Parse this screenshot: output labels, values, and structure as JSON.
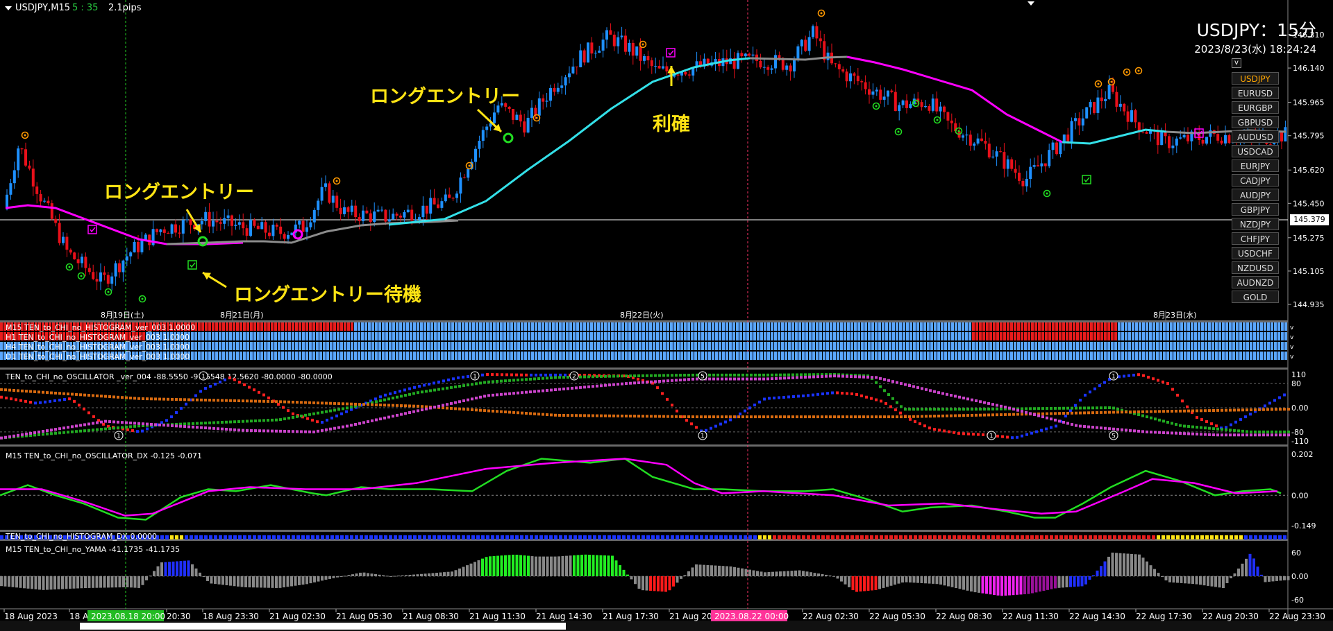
{
  "chart_header": {
    "symbol_timeframe": "USDJPY,M15",
    "countdown": "5 : 35",
    "spread": "2.1pips"
  },
  "overlay": {
    "title": "USDJPY：15分",
    "datetime": "2023/8/23(水) 18:24:24",
    "v_button": "v"
  },
  "symbols": [
    "USDJPY",
    "EURUSD",
    "EURGBP",
    "GBPUSD",
    "AUDUSD",
    "USDCAD",
    "EURJPY",
    "CADJPY",
    "AUDJPY",
    "GBPJPY",
    "NZDJPY",
    "CHFJPY",
    "USDCHF",
    "NZDUSD",
    "AUDNZD",
    "GOLD"
  ],
  "active_symbol": "USDJPY",
  "annotations": {
    "long_entry_1": "ロングエントリー",
    "long_entry_2": "ロングエントリー",
    "long_entry_wait": "ロングエントリー待機",
    "take_profit": "利確"
  },
  "colors": {
    "background": "#000000",
    "bull": "#1e90ff",
    "bear": "#e8101a",
    "ma_magenta": "#ff00ff",
    "ma_cyan": "#33e0e8",
    "ma_gray": "#8c8c8c",
    "annotation": "#ffe414",
    "marker_green": "#22dd22",
    "marker_orange": "#ff9900",
    "osc_blue": "#1a33ff",
    "osc_red": "#ff2020",
    "osc_green": "#22aa22",
    "osc_orange": "#d86a10",
    "osc_purple": "#cc44cc"
  },
  "price_axis": {
    "labels": [
      "146.310",
      "146.140",
      "145.965",
      "145.795",
      "145.620",
      "145.450",
      "145.275",
      "145.105",
      "144.935"
    ],
    "current_price": "145.379"
  },
  "date_labels": [
    "8月19日(土)",
    "8月21日(月)",
    "8月22日(火)",
    "8月23日(水)"
  ],
  "histogram_panels": [
    "M15 TEN_to_CHI_no_HISTOGRAM_ver_003 1.0000",
    "H1 TEN_to_CHI_no_HISTOGRAM_ver_003 1.0000",
    "H4 TEN_to_CHI_no_HISTOGRAM_ver_003 1.0000",
    "D1 TEN_to_CHI_no_HISTOGRAM_ver_003 1.0000"
  ],
  "oscillator": {
    "label": "TEN_to_CHI_no_OSCILLATOR _ver_004 -88.5550 -91.6548 12.5620 -80.0000 -80.0000",
    "axis": [
      "110",
      "80",
      "0.00",
      "-80",
      "-110"
    ],
    "markers_top": [
      "1",
      "1",
      "2",
      "5",
      "1"
    ],
    "markers_bottom": [
      "1",
      "1",
      "1",
      "5"
    ]
  },
  "dx": {
    "label": "M15 TEN_to_CHI_no_OSCILLATOR_DX  -0.125 -0.071",
    "axis": [
      "0.202",
      "0.00",
      "-0.149"
    ]
  },
  "histogram_dx": {
    "label": "TEN_to_CHI_no_HISTOGRAM_DX 0.0000"
  },
  "yama": {
    "label": "M15  TEN_to_CHI_no_YAMA  -41.1735  -41.1735",
    "axis": [
      "60",
      "0.00",
      "-60"
    ]
  },
  "time_axis": {
    "labels": [
      "18 Aug 2023",
      "18 A",
      "20:30",
      "18 Aug 23:30",
      "21 Aug 02:30",
      "21 Aug 05:30",
      "21 Aug 08:30",
      "21 Aug 11:30",
      "21 Aug 14:30",
      "21 Aug 17:30",
      "21 Aug 20",
      "22 Aug 02:30",
      "22 Aug 05:30",
      "22 Aug 08:30",
      "22 Aug 11:30",
      "22 Aug 14:30",
      "22 Aug 17:30",
      "22 Aug 20:30",
      "22 Aug 23:30"
    ],
    "cursor_green": "2023.08.18 20:00",
    "cursor_pink": "2023.08.22 00:00"
  }
}
